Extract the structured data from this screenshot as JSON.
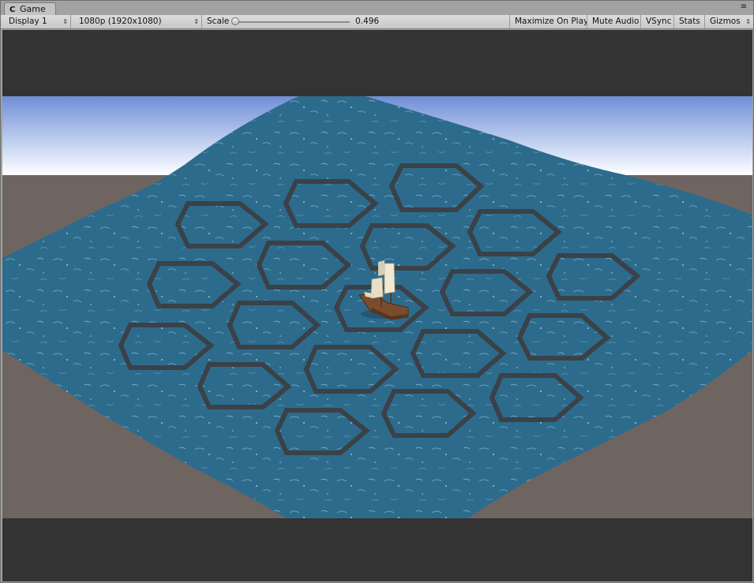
{
  "window": {
    "tab_icon": "C",
    "tab_title": "Game",
    "menu_icon": "≡"
  },
  "toolbar": {
    "display": "Display 1",
    "resolution": "1080p (1920x1080)",
    "scale_label": "Scale",
    "scale_value": "0.496",
    "scale_fraction": 0.0,
    "maximize": "Maximize On Play",
    "mute": "Mute Audio",
    "vsync": "VSync",
    "stats": "Stats",
    "gizmos": "Gizmos"
  },
  "scene": {
    "sky_top": "#6f8fd6",
    "sky_horizon": "#ffffff",
    "ground_color": "#6e6560",
    "water_color": "#2e6a8c",
    "hex_outline_color": "#3a3f44",
    "boat_hull_color": "#7a4c2e",
    "sail_color": "#e9dfc8",
    "hex_tiles": 19,
    "boat": "ship"
  }
}
